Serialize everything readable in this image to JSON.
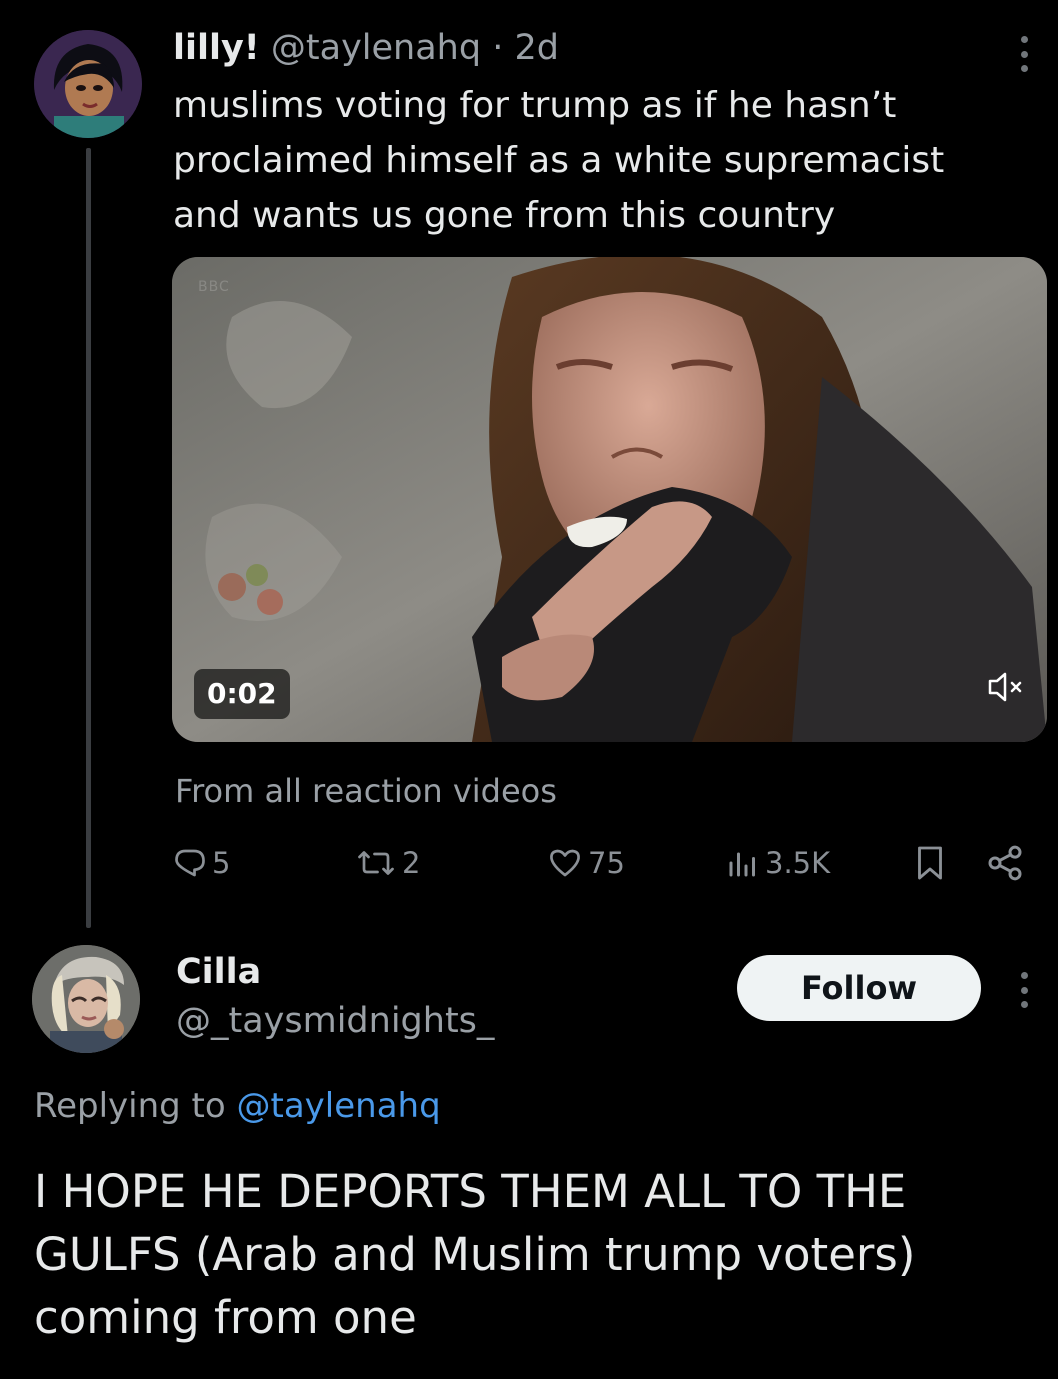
{
  "tweet": {
    "display_name": "lilly!",
    "handle": "@taylenahq",
    "separator": "·",
    "time": "2d",
    "text": "muslims voting for trump as if he hasn’t proclaimed himself as a white supremacist and wants us gone from this country",
    "media": {
      "duration": "0:02",
      "watermark": "BBC",
      "sound_icon": "muted-speaker-icon"
    },
    "source": "From all reaction videos",
    "actions": {
      "replies": "5",
      "retweets": "2",
      "likes": "75",
      "views": "3.5K"
    }
  },
  "reply": {
    "display_name": "Cilla",
    "handle": "@_taysmidnights_",
    "follow_label": "Follow",
    "replying_prefix": "Replying to",
    "replying_to": "@taylenahq",
    "text": "I HOPE HE DEPORTS THEM ALL TO THE GULFS (Arab and Muslim trump voters) coming from one"
  },
  "colors": {
    "background": "#000000",
    "primary_text": "#e7e9ea",
    "secondary_text": "#9aa0a6",
    "link": "#4a99e9",
    "follow_button": "#eff3f4"
  },
  "icons": {
    "reply": "reply-bubble-icon",
    "retweet": "retweet-arrows-icon",
    "like": "heart-icon",
    "views": "bar-chart-icon",
    "bookmark": "bookmark-icon",
    "share": "share-nodes-icon",
    "more": "more-vertical-icon"
  }
}
